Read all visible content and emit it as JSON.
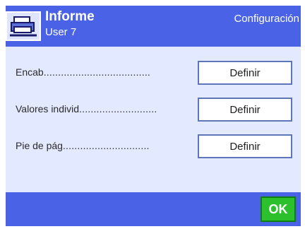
{
  "header": {
    "title": "Informe",
    "user": "User 7",
    "section": "Configuración",
    "icon": "printer-icon"
  },
  "rows": [
    {
      "label": "Encab",
      "button_label": "Definir"
    },
    {
      "label": "Valores individ",
      "button_label": "Definir"
    },
    {
      "label": "Pie de pág",
      "button_label": "Definir"
    }
  ],
  "footer": {
    "ok_label": "OK"
  },
  "colors": {
    "header_bg": "#4a63e6",
    "content_bg": "#e3e9ff",
    "ok_bg": "#2cc02c",
    "button_border": "#5c76b8"
  }
}
